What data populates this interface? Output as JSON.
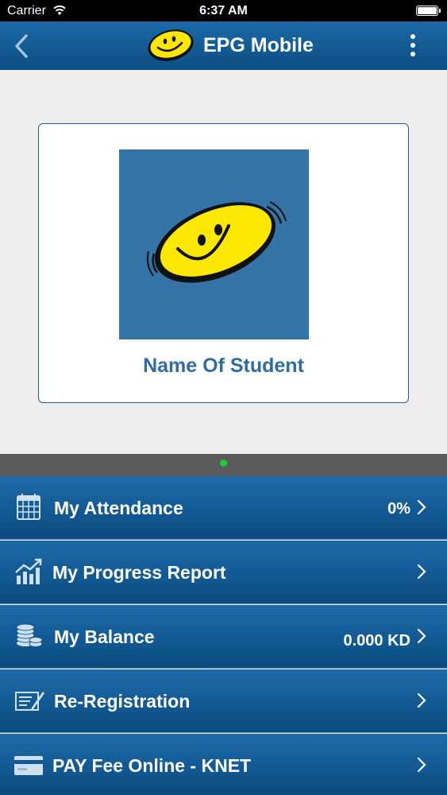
{
  "status_bar": {
    "carrier": "Carrier",
    "time": "6:37 AM"
  },
  "nav_bar": {
    "title": "EPG Mobile"
  },
  "profile": {
    "student_name": "Name Of Student"
  },
  "menu": [
    {
      "label": "My Attendance",
      "value": "0%",
      "icon": "calendar-icon"
    },
    {
      "label": "My Progress Report",
      "value": "",
      "icon": "chart-icon"
    },
    {
      "label": "My Balance",
      "value": "0.000 KD",
      "icon": "coins-icon"
    },
    {
      "label": "Re-Registration",
      "value": "",
      "icon": "form-icon"
    },
    {
      "label": "PAY Fee Online - KNET",
      "value": "",
      "icon": "credit-card-icon"
    }
  ],
  "colors": {
    "brand_blue": "#135b96",
    "name_blue": "#2e6ca4",
    "smiley_yellow": "#fce700",
    "page_indicator": "#19d23a"
  }
}
